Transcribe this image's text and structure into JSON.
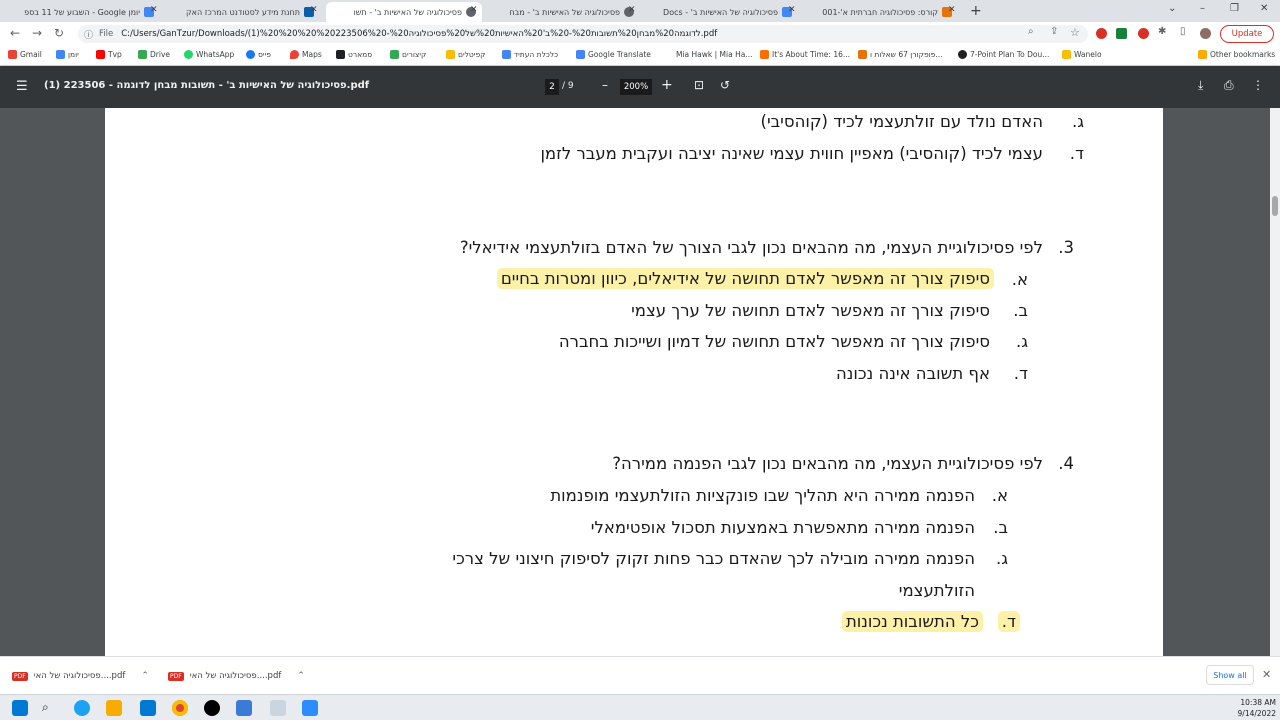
{
  "tabs": [
    {
      "label": "יומן Google - השבוע של 11 בספ",
      "color": "#4285f4",
      "active": false
    },
    {
      "label": "תחנת מידע לסטודנט המרכז האק",
      "color": "#0b5ea8",
      "active": false
    },
    {
      "label": "פסיכולוגיה של האישיות ב' - תשו",
      "color": "#5f6368",
      "active": true
    },
    {
      "label": "פסיכולוגיה של האישיות ב' - מבח",
      "color": "#5f6368",
      "active": false
    },
    {
      "label": "פסיכולוגיה של האישיות ב' - Docs",
      "color": "#4285f4",
      "active": false
    },
    {
      "label": "קורס: פסיכולוגיה חברתית א'-001",
      "color": "#e8710a",
      "active": false
    }
  ],
  "new_tab": "+",
  "window_controls": {
    "minimize": "–",
    "maximize": "❐",
    "close": "✕",
    "caret": "⌄"
  },
  "address": {
    "scheme_label": "File",
    "url": "C:/Users/GanTzur/Downloads/(1)%20%20%20%20223506%20-%20לדוגמה%20מבחן%20תשובות%20-%20ב'%20האישיות%20של%20פסיכולוגיה.pdf"
  },
  "update_label": "Update",
  "bookmarks": [
    {
      "label": "Gmail",
      "color": "#ea4335"
    },
    {
      "label": "יומן",
      "color": "#4285f4"
    },
    {
      "label": "Tvp",
      "color": "#ff0000"
    },
    {
      "label": "Drive",
      "color": "#34a853"
    },
    {
      "label": "WhatsApp",
      "color": "#25d366"
    },
    {
      "label": "פייס",
      "color": "#1877f2"
    },
    {
      "label": "Maps",
      "color": "#ea4335"
    },
    {
      "label": "סמארט",
      "color": "#202124"
    },
    {
      "label": "קיצורים",
      "color": "#34a853"
    },
    {
      "label": "קפיטלים",
      "color": "#fbbc04"
    },
    {
      "label": "כלכלת העתיד",
      "color": "#4285f4"
    },
    {
      "label": "Google Translate",
      "color": "#4285f4"
    },
    {
      "label": "Mia Hawk | Mia Ha...",
      "color": "#ffffff"
    },
    {
      "label": "It's About Time: 16...",
      "color": "#ff6d00"
    },
    {
      "label": "פופקורן 67 שאלות ו...",
      "color": "#e8710a"
    },
    {
      "label": "7-Point Plan To Dou...",
      "color": "#202124"
    },
    {
      "label": "Wanelo",
      "color": "#fbbc04"
    }
  ],
  "other_bookmarks": "Other bookmarks",
  "pdf": {
    "title": "פסיכולוגיה של האישיות ב' - תשובות מבחן לדוגמה - 223506 (1).pdf",
    "page": "2",
    "total": "/  9",
    "zoom": "200%",
    "zoom_out": "–",
    "zoom_in": "+"
  },
  "document": {
    "prev_options": [
      {
        "letter": "ג.",
        "text": "האדם נולד עם זולתעצמי לכיד (קוהסיבי)"
      },
      {
        "letter": "ד.",
        "text": "עצמי לכיד (קוהסיבי) מאפיין חווית עצמי שאינה יציבה ועקבית מעבר לזמן"
      }
    ],
    "questions": [
      {
        "number": "3.",
        "question": "לפי פסיכולוגיית העצמי, מה מהבאים נכון לגבי הצורך של האדם בזולתעצמי אידיאלי?",
        "options": [
          {
            "letter": "א.",
            "text": "סיפוק צורך זה מאפשר לאדם תחושה של אידיאלים, כיוון ומטרות בחיים",
            "highlight": true
          },
          {
            "letter": "ב.",
            "text": "סיפוק צורך זה מאפשר לאדם תחושה של ערך עצמי",
            "highlight": false
          },
          {
            "letter": "ג.",
            "text": "סיפוק צורך זה מאפשר לאדם תחושה של דמיון ושייכות בחברה",
            "highlight": false
          },
          {
            "letter": "ד.",
            "text": "אף תשובה אינה נכונה",
            "highlight": false
          }
        ]
      },
      {
        "number": "4.",
        "question": "לפי פסיכולוגיית העצמי, מה מהבאים נכון לגבי הפנמה ממירה?",
        "options": [
          {
            "letter": "א.",
            "text": "הפנמה ממירה היא תהליך שבו פונקציות הזולתעצמי מופנמות",
            "highlight": false
          },
          {
            "letter": "ב.",
            "text": "הפנמה ממירה מתאפשרת באמצעות תסכול אופטימאלי",
            "highlight": false
          },
          {
            "letter": "ג.",
            "text": "הפנמה ממירה מובילה לכך שהאדם כבר פחות זקוק לסיפוק חיצוני של צרכי",
            "continuation": "הזולתעצמי",
            "highlight": false
          },
          {
            "letter": "ד.",
            "text": "כל התשובות נכונות",
            "highlight": true
          }
        ]
      }
    ]
  },
  "downloads": [
    {
      "label": "פסיכולוגיה של האי....pdf",
      "badge": "PDF"
    },
    {
      "label": "פסיכולוגיה של האי....pdf",
      "badge": "PDF"
    }
  ],
  "show_all": "Show all",
  "clock": {
    "time": "10:38 AM",
    "date": "9/14/2022"
  },
  "colors": {
    "highlight": "#fdf1a8",
    "pdf_toolbar": "#323639",
    "viewer_bg": "#525659"
  }
}
